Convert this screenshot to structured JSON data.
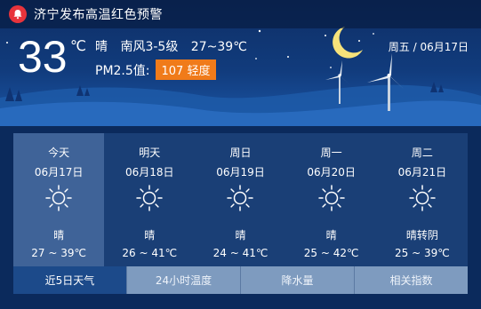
{
  "alert": {
    "text": "济宁发布高温红色预警",
    "icon": "bell-icon",
    "color": "#e8343c"
  },
  "current": {
    "temperature": "33",
    "unit": "℃",
    "condition": "晴",
    "wind": "南风3-5级",
    "range": "27~39℃",
    "pm_label": "PM2.5值:",
    "aqi_value": "107",
    "aqi_level": "轻度",
    "aqi_badge": "107 轻度",
    "aqi_color": "#f07b1a",
    "date_text": "周五 / 06月17日"
  },
  "forecast": [
    {
      "name": "今天",
      "date": "06月17日",
      "icon": "sun-icon",
      "condition": "晴",
      "range": "27 ~ 39℃"
    },
    {
      "name": "明天",
      "date": "06月18日",
      "icon": "sun-icon",
      "condition": "晴",
      "range": "26 ~ 41℃"
    },
    {
      "name": "周日",
      "date": "06月19日",
      "icon": "sun-icon",
      "condition": "晴",
      "range": "24 ~ 41℃"
    },
    {
      "name": "周一",
      "date": "06月20日",
      "icon": "sun-icon",
      "condition": "晴",
      "range": "25 ~ 42℃"
    },
    {
      "name": "周二",
      "date": "06月21日",
      "icon": "sun-icon",
      "condition": "晴转阴",
      "range": "25 ~ 39℃"
    }
  ],
  "tabs": [
    {
      "label": "近5日天气"
    },
    {
      "label": "24小时温度"
    },
    {
      "label": "降水量"
    },
    {
      "label": "相关指数"
    }
  ]
}
